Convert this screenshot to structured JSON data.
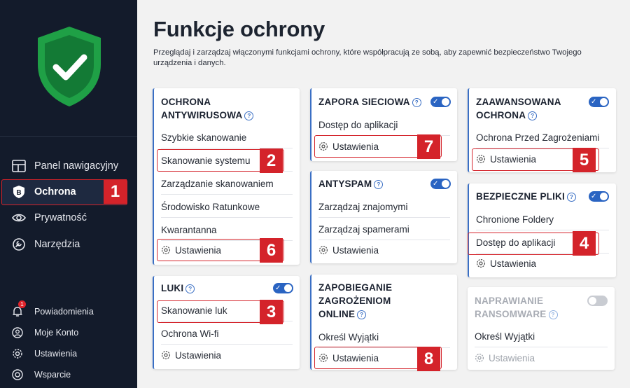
{
  "sidebar": {
    "nav": [
      {
        "label": "Panel nawigacyjny",
        "icon": "dashboard-icon"
      },
      {
        "label": "Ochrona",
        "icon": "shield-b-icon"
      },
      {
        "label": "Prywatność",
        "icon": "eye-icon"
      },
      {
        "label": "Narzędzia",
        "icon": "tools-icon"
      }
    ],
    "bottom": [
      {
        "label": "Powiadomienia",
        "icon": "bell-icon",
        "badge": "1"
      },
      {
        "label": "Moje Konto",
        "icon": "account-icon"
      },
      {
        "label": "Ustawienia",
        "icon": "gear-icon"
      },
      {
        "label": "Wsparcie",
        "icon": "support-icon"
      }
    ]
  },
  "page": {
    "title": "Funkcje ochrony",
    "description": "Przeglądaj i zarządzaj włączonymi funkcjami ochrony, które współpracują ze sobą, aby zapewnić bezpieczeństwo Twojego urządzenia i danych."
  },
  "cards": {
    "antivirus": {
      "title_line1": "OCHRONA",
      "title_line2": "ANTYWIRUSOWA",
      "items": [
        "Szybkie skanowanie",
        "Skanowanie systemu",
        "Zarządzanie skanowaniem",
        "Środowisko Ratunkowe",
        "Kwarantanna"
      ],
      "settings": "Ustawienia"
    },
    "vulnerabilities": {
      "title": "LUKI",
      "toggle": true,
      "items": [
        "Skanowanie luk",
        "Ochrona Wi-fi"
      ],
      "settings": "Ustawienia"
    },
    "firewall": {
      "title": "ZAPORA SIECIOWA",
      "toggle": true,
      "items": [
        "Dostęp do aplikacji"
      ],
      "settings": "Ustawienia"
    },
    "antispam": {
      "title": "ANTYSPAM",
      "toggle": true,
      "items": [
        "Zarządzaj znajomymi",
        "Zarządzaj spamerami"
      ],
      "settings": "Ustawienia"
    },
    "online_threats": {
      "title_line1": "ZAPOBIEGANIE",
      "title_line2": "ZAGROŻENIOM",
      "title_line3": "ONLINE",
      "items": [
        "Określ Wyjątki"
      ],
      "settings": "Ustawienia"
    },
    "advanced": {
      "title_line1": "ZAAWANSOWANA",
      "title_line2": "OCHRONA",
      "toggle": true,
      "items": [
        "Ochrona Przed Zagrożeniami"
      ],
      "settings": "Ustawienia"
    },
    "safe_files": {
      "title": "BEZPIECZNE PLIKI",
      "toggle": true,
      "items": [
        "Chronione Foldery",
        "Dostęp do aplikacji"
      ],
      "settings": "Ustawienia"
    },
    "ransomware": {
      "title_line1": "NAPRAWIANIE",
      "title_line2": "RANSOMWARE",
      "toggle": false,
      "items": [
        "Określ Wyjątki"
      ],
      "settings": "Ustawienia"
    }
  },
  "markers": [
    "1",
    "2",
    "3",
    "4",
    "5",
    "6",
    "7",
    "8"
  ],
  "colors": {
    "sidebar_bg": "#131b2b",
    "accent": "#2a64c2",
    "marker": "#d4232a",
    "shield_green": "#1fa046"
  }
}
